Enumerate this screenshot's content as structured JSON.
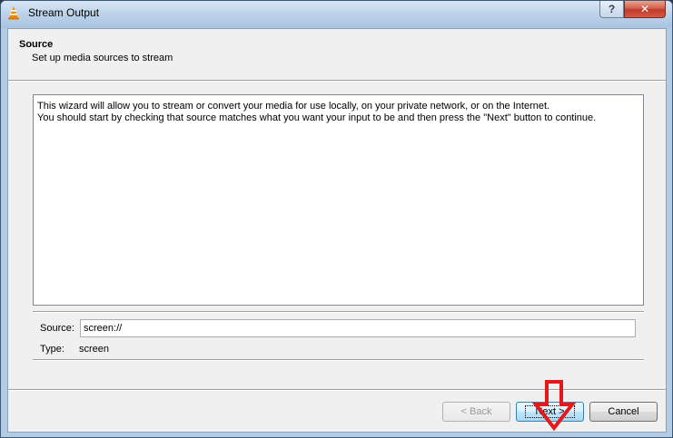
{
  "window": {
    "title": "Stream Output",
    "help_label": "?",
    "close_label": "✕"
  },
  "header": {
    "title": "Source",
    "subtitle": "Set up media sources to stream"
  },
  "info": {
    "line1": "This wizard will allow you to stream or convert your media for use locally, on your private network, or on the Internet.",
    "line2": "You should start by checking that source matches what you want your input to be and then press the \"Next\" button to continue."
  },
  "source": {
    "label": "Source:",
    "value": "screen://"
  },
  "type": {
    "label": "Type:",
    "value": "screen"
  },
  "buttons": {
    "back": "< Back",
    "next": "Next >",
    "cancel": "Cancel"
  },
  "colors": {
    "annotation_arrow": "#e81818",
    "vlc_cone": "#f08a00"
  }
}
